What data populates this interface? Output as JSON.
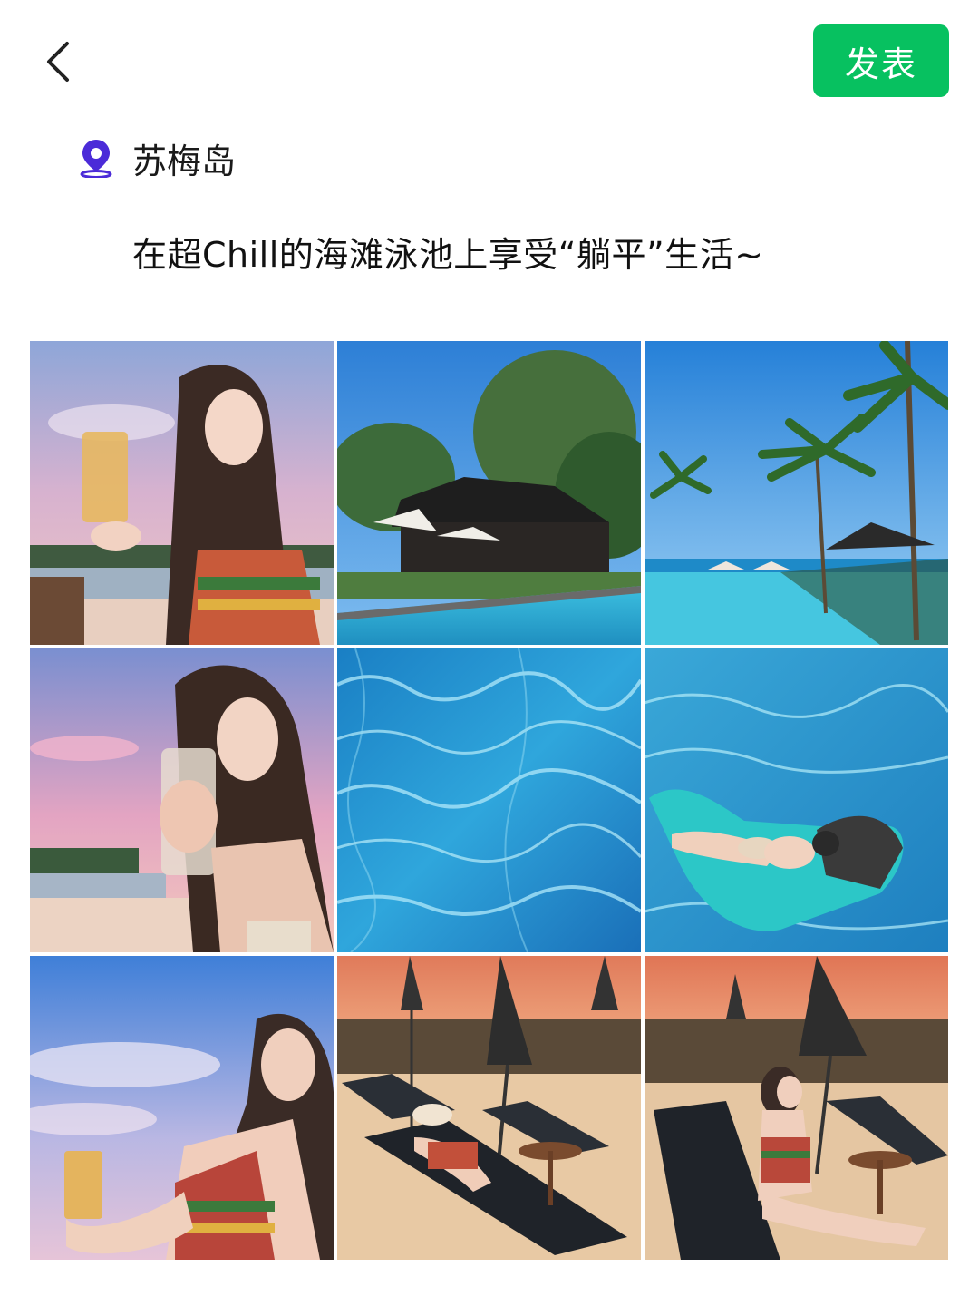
{
  "header": {
    "back_icon": "chevron-left-icon",
    "post_label": "发表",
    "post_color": "#07c160"
  },
  "location": {
    "icon": "location-pin-icon",
    "icon_color": "#4b2bd8",
    "name": "苏梅岛"
  },
  "post": {
    "caption": "在超Chill的海滩泳池上享受“躺平”生活~"
  },
  "photos": [
    {
      "id": 1,
      "scene": "woman-with-beer-sunset-sky"
    },
    {
      "id": 2,
      "scene": "resort-pool-with-pavilion"
    },
    {
      "id": 3,
      "scene": "infinity-pool-palm-trees"
    },
    {
      "id": 4,
      "scene": "woman-drinking-pink-sky"
    },
    {
      "id": 5,
      "scene": "pool-water-close-up"
    },
    {
      "id": 6,
      "scene": "woman-on-pool-float"
    },
    {
      "id": 7,
      "scene": "woman-looking-up-blue-sky"
    },
    {
      "id": 8,
      "scene": "beach-loungers-sunset"
    },
    {
      "id": 9,
      "scene": "woman-on-lounger-sunset"
    }
  ]
}
